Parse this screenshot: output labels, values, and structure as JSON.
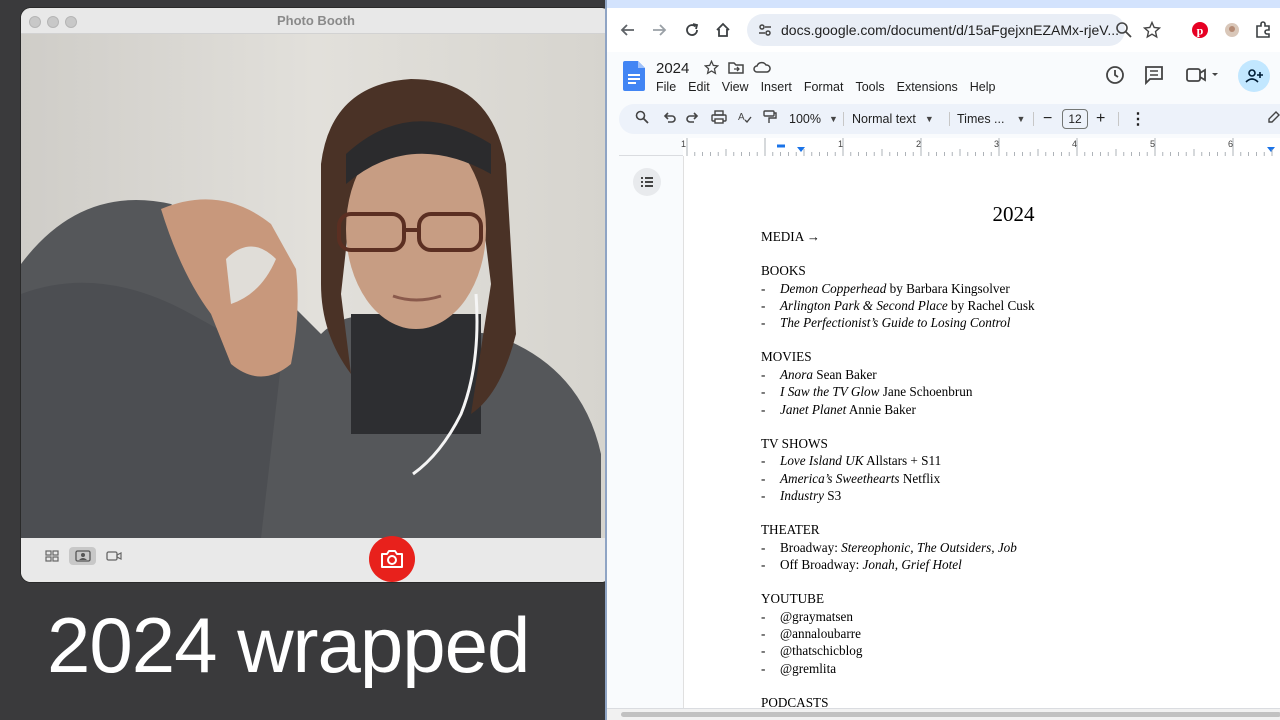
{
  "photo_booth": {
    "title": "Photo Booth",
    "view_buttons": [
      "grid-view-icon",
      "single-photo-icon",
      "video-icon"
    ],
    "shutter_icon": "camera-icon"
  },
  "caption": "2024 wrapped",
  "browser": {
    "url": "docs.google.com/document/d/15aFgejxnEZAMx-rjeV...",
    "icons": [
      "back-arrow-icon",
      "forward-arrow-icon",
      "reload-icon",
      "home-icon",
      "site-info-icon",
      "zoom-icon",
      "bookmark-star-icon",
      "pinterest-icon",
      "extension-icon",
      "puzzle-icon"
    ]
  },
  "docs": {
    "doc_title": "2024",
    "menu": [
      "File",
      "Edit",
      "View",
      "Insert",
      "Format",
      "Tools",
      "Extensions",
      "Help"
    ],
    "toolbar": {
      "zoom": "100%",
      "style": "Normal text",
      "font": "Times ...",
      "font_size": "12"
    },
    "ruler_numbers": [
      "1",
      "1",
      "2",
      "3",
      "4",
      "5",
      "6"
    ]
  },
  "document": {
    "heading": "2024",
    "media_label": "MEDIA →",
    "sections": [
      {
        "title": "BOOKS",
        "items": [
          {
            "italic": "Demon Copperhead",
            "rest": " by Barbara Kingsolver"
          },
          {
            "italic": "Arlington Park & Second Place",
            "rest": " by Rachel Cusk"
          },
          {
            "italic": "The Perfectionist’s Guide to Losing Control",
            "rest": ""
          }
        ]
      },
      {
        "title": "MOVIES",
        "items": [
          {
            "italic": "Anora",
            "rest": " Sean Baker"
          },
          {
            "italic": "I Saw the TV Glow",
            "rest": " Jane Schoenbrun"
          },
          {
            "italic": "Janet Planet",
            "rest": " Annie Baker"
          }
        ]
      },
      {
        "title": "TV SHOWS",
        "items": [
          {
            "italic": "Love Island UK",
            "rest": " Allstars + S11"
          },
          {
            "italic": "America’s Sweethearts",
            "rest": " Netflix"
          },
          {
            "italic": "Industry",
            "rest": " S3"
          }
        ]
      },
      {
        "title": "THEATER",
        "items": [
          {
            "plain": "Broadway: ",
            "italic": "Stereophonic, The Outsiders, Job"
          },
          {
            "plain": "Off Broadway: ",
            "italic": "Jonah, Grief Hotel"
          }
        ]
      },
      {
        "title": "YOUTUBE",
        "items": [
          {
            "plain": "@graymatsen"
          },
          {
            "plain": "@annaloubarre"
          },
          {
            "plain": "@thatschicblog"
          },
          {
            "plain": "@gremlita"
          }
        ]
      },
      {
        "title": "PODCASTS",
        "items": []
      }
    ]
  }
}
